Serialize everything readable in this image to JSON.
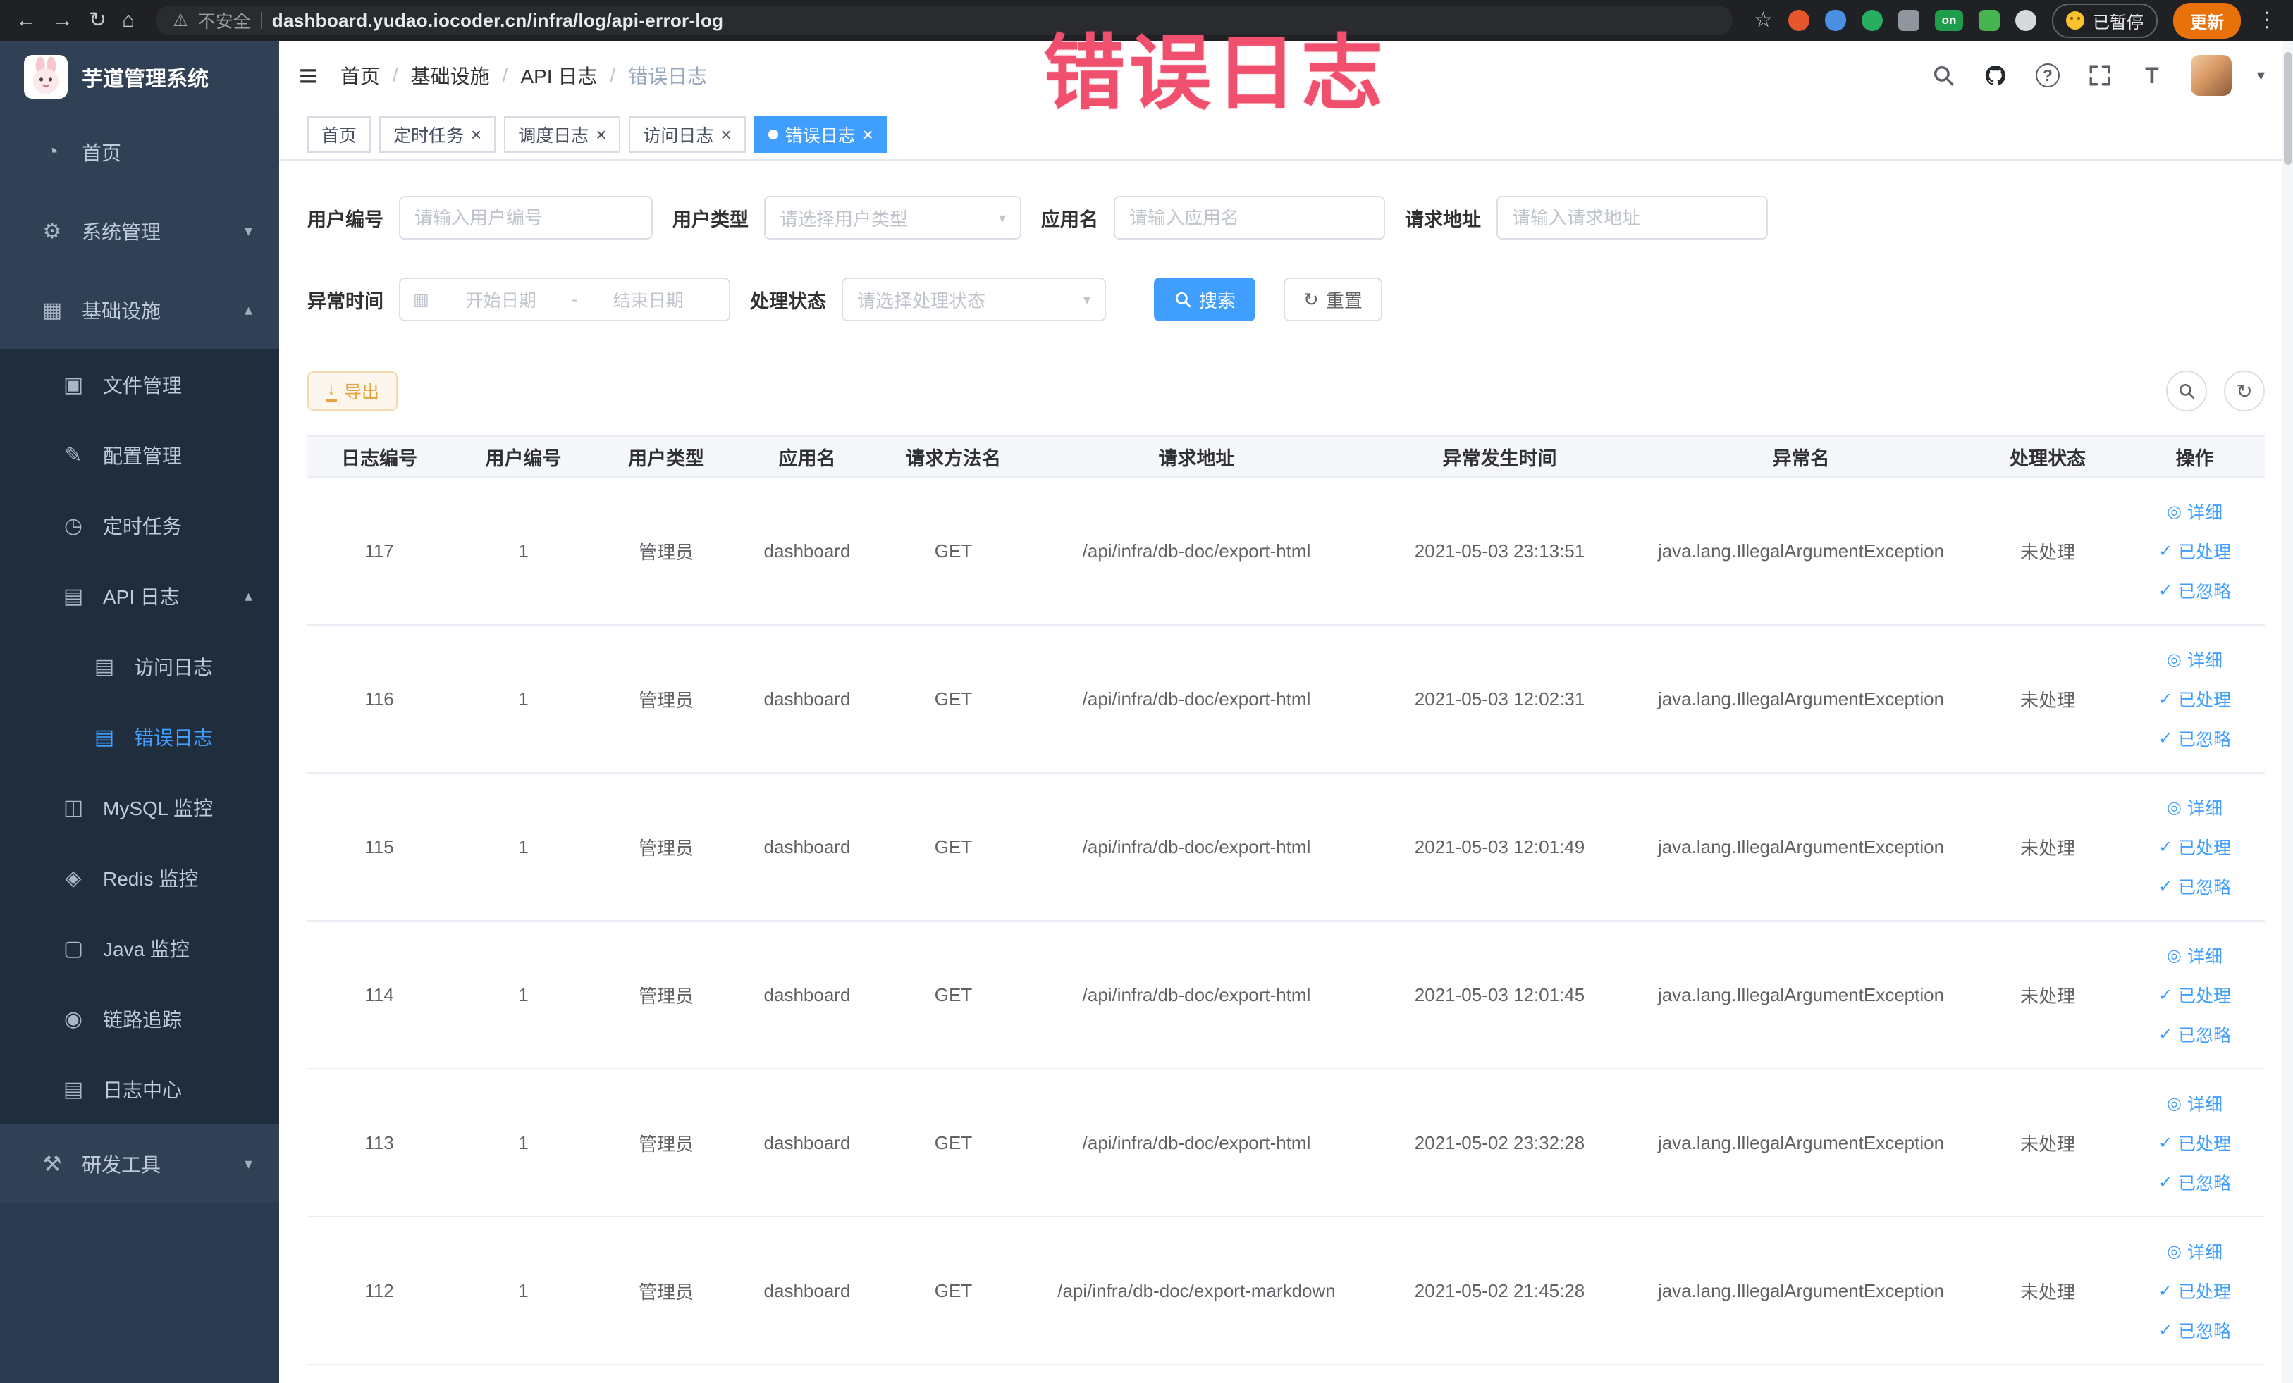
{
  "colors": {
    "primary": "#409EFF",
    "warning": "#E6A23C",
    "annotation": "#F0506E",
    "sidebar_bg": "#304156",
    "sidebar_submenu_bg": "#1F2D3D",
    "update_button_bg": "#E8710A"
  },
  "browser": {
    "security_label": "不安全",
    "url": "dashboard.yudao.iocoder.cn/infra/log/api-error-log",
    "extension_badge": "on",
    "paused_badge": "已暂停",
    "update_button": "更新"
  },
  "icons": {
    "back": "←",
    "forward": "→",
    "reload": "↻",
    "home": "⌂",
    "warning": "⚠",
    "star": "☆",
    "dots": "⋮",
    "menu": "≡",
    "caret_down": "▾",
    "caret_up": "▴",
    "close": "×",
    "check": "✓",
    "eye": "◎",
    "refresh": "↻",
    "download": "↓",
    "calendar": "▦",
    "question": "?",
    "font_size": "T",
    "dashboard": "◔",
    "gear": "⚙",
    "infra": "▦",
    "folder": "▣",
    "edit": "✎",
    "timer": "◷",
    "doc": "▤",
    "grid": "◫",
    "db": "◈",
    "monitor": "▢",
    "trace": "◉",
    "tools": "⚒"
  },
  "sidebar": {
    "logo_title": "芋道管理系统",
    "home": "首页",
    "system": "系统管理",
    "infra": "基础设施",
    "file": "文件管理",
    "config": "配置管理",
    "job": "定时任务",
    "api_log": "API 日志",
    "access_log": "访问日志",
    "error_log": "错误日志",
    "mysql": "MySQL 监控",
    "redis": "Redis 监控",
    "java": "Java 监控",
    "trace": "链路追踪",
    "log_center": "日志中心",
    "dev_tools": "研发工具"
  },
  "header": {
    "separator": "/",
    "breadcrumbs": [
      "首页",
      "基础设施",
      "API 日志",
      "错误日志"
    ]
  },
  "annotation": "错误日志",
  "tabs": [
    {
      "label": "首页",
      "closable": false,
      "active": false
    },
    {
      "label": "定时任务",
      "closable": true,
      "active": false
    },
    {
      "label": "调度日志",
      "closable": true,
      "active": false
    },
    {
      "label": "访问日志",
      "closable": true,
      "active": false
    },
    {
      "label": "错误日志",
      "closable": true,
      "active": true
    }
  ],
  "filters": {
    "user_id": {
      "label": "用户编号",
      "placeholder": "请输入用户编号",
      "value": ""
    },
    "user_type": {
      "label": "用户类型",
      "placeholder": "请选择用户类型"
    },
    "app_name": {
      "label": "应用名",
      "placeholder": "请输入应用名",
      "value": ""
    },
    "request_url": {
      "label": "请求地址",
      "placeholder": "请输入请求地址",
      "value": ""
    },
    "exception_time": {
      "label": "异常时间",
      "start_placeholder": "开始日期",
      "separator": "-",
      "end_placeholder": "结束日期"
    },
    "process_status": {
      "label": "处理状态",
      "placeholder": "请选择处理状态"
    },
    "search_button": "搜索",
    "reset_button": "重置"
  },
  "toolbar": {
    "export_button": "导出"
  },
  "table": {
    "columns": [
      "日志编号",
      "用户编号",
      "用户类型",
      "应用名",
      "请求方法名",
      "请求地址",
      "异常发生时间",
      "异常名",
      "处理状态",
      "操作"
    ],
    "actions": {
      "detail": "详细",
      "processed": "已处理",
      "ignored": "已忽略"
    },
    "rows": [
      {
        "id": "117",
        "user_id": "1",
        "user_type": "管理员",
        "app": "dashboard",
        "method": "GET",
        "url": "/api/infra/db-doc/export-html",
        "time": "2021-05-03 23:13:51",
        "exception": "java.lang.IllegalArgumentException",
        "status": "未处理"
      },
      {
        "id": "116",
        "user_id": "1",
        "user_type": "管理员",
        "app": "dashboard",
        "method": "GET",
        "url": "/api/infra/db-doc/export-html",
        "time": "2021-05-03 12:02:31",
        "exception": "java.lang.IllegalArgumentException",
        "status": "未处理"
      },
      {
        "id": "115",
        "user_id": "1",
        "user_type": "管理员",
        "app": "dashboard",
        "method": "GET",
        "url": "/api/infra/db-doc/export-html",
        "time": "2021-05-03 12:01:49",
        "exception": "java.lang.IllegalArgumentException",
        "status": "未处理"
      },
      {
        "id": "114",
        "user_id": "1",
        "user_type": "管理员",
        "app": "dashboard",
        "method": "GET",
        "url": "/api/infra/db-doc/export-html",
        "time": "2021-05-03 12:01:45",
        "exception": "java.lang.IllegalArgumentException",
        "status": "未处理"
      },
      {
        "id": "113",
        "user_id": "1",
        "user_type": "管理员",
        "app": "dashboard",
        "method": "GET",
        "url": "/api/infra/db-doc/export-html",
        "time": "2021-05-02 23:32:28",
        "exception": "java.lang.IllegalArgumentException",
        "status": "未处理"
      },
      {
        "id": "112",
        "user_id": "1",
        "user_type": "管理员",
        "app": "dashboard",
        "method": "GET",
        "url": "/api/infra/db-doc/export-markdown",
        "time": "2021-05-02 21:45:28",
        "exception": "java.lang.IllegalArgumentException",
        "status": "未处理"
      }
    ]
  }
}
